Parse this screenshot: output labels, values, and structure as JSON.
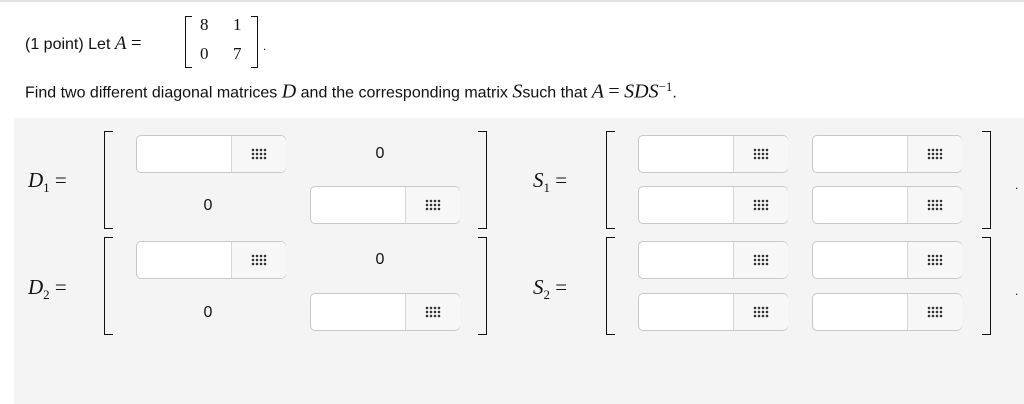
{
  "problem": {
    "points": "(1 point) Let",
    "matrix_var": "A",
    "equals": "=",
    "matrix_A": [
      [
        "8",
        "1"
      ],
      [
        "0",
        "7"
      ]
    ],
    "period": ".",
    "instruction_pre": "Find two different diagonal matrices",
    "instruction_D": "D",
    "instruction_mid": "and the corresponding matrix",
    "instruction_S": "S",
    "instruction_post": "such that",
    "formula_lhs": "A",
    "formula_eq": "=",
    "formula_rhs": "SDS",
    "formula_exp": "−1",
    "formula_end": "."
  },
  "answer": {
    "D1_label": "D",
    "D1_sub": "1",
    "D2_label": "D",
    "D2_sub": "2",
    "S1_label": "S",
    "S1_sub": "1",
    "S2_label": "S",
    "S2_sub": "2",
    "eq": "=",
    "zero": "0",
    "trailing_dot": ".",
    "matrix_button_icon": "matrix-grid-icon"
  }
}
